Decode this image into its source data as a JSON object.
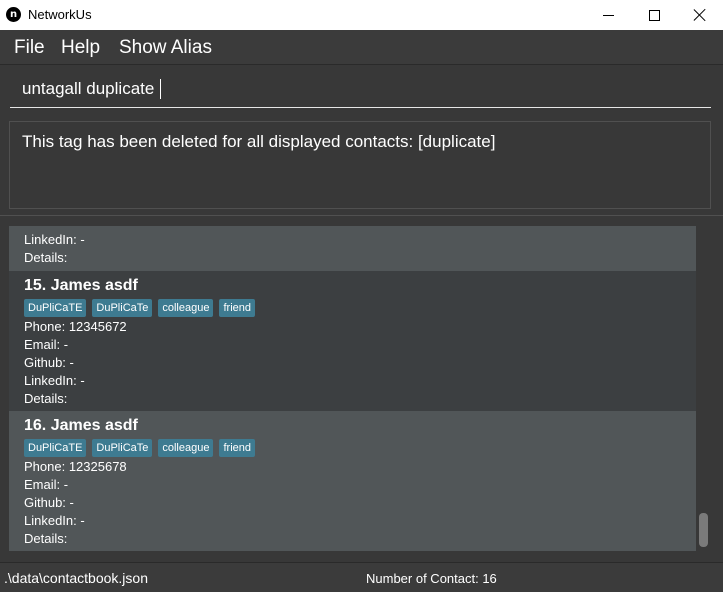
{
  "window": {
    "title": "NetworkUs",
    "icon_glyph": "n",
    "minimize_icon": "minimize-icon",
    "maximize_icon": "maximize-icon",
    "close_icon": "close-icon"
  },
  "menu": {
    "items": [
      {
        "label": "File"
      },
      {
        "label": "Help"
      },
      {
        "label": "Show Alias"
      }
    ]
  },
  "command": {
    "value": "untagall duplicate"
  },
  "result": {
    "message": "This tag has been deleted for all displayed contacts: [duplicate]"
  },
  "persons": {
    "partial": {
      "linkedin": "LinkedIn: -",
      "details": "Details:"
    },
    "cards": [
      {
        "name": "15.  James asdf",
        "tags": [
          "DuPliCaTE",
          "DuPliCaTe",
          "colleague",
          "friend"
        ],
        "phone": "Phone: 12345672",
        "email": "Email: -",
        "github": "Github: -",
        "linkedin": "LinkedIn: -",
        "details": "Details:"
      },
      {
        "name": "16.  James asdf",
        "tags": [
          "DuPliCaTE",
          "DuPliCaTe",
          "colleague",
          "friend"
        ],
        "phone": "Phone: 12325678",
        "email": "Email: -",
        "github": "Github: -",
        "linkedin": "LinkedIn: -",
        "details": "Details:"
      }
    ]
  },
  "status": {
    "path": ".\\data\\contactbook.json",
    "count": "Number of Contact: 16"
  },
  "colors": {
    "background": "#383838",
    "card_dark": "#3c3f41",
    "card_light": "#515658",
    "tag": "#3e7b91"
  }
}
